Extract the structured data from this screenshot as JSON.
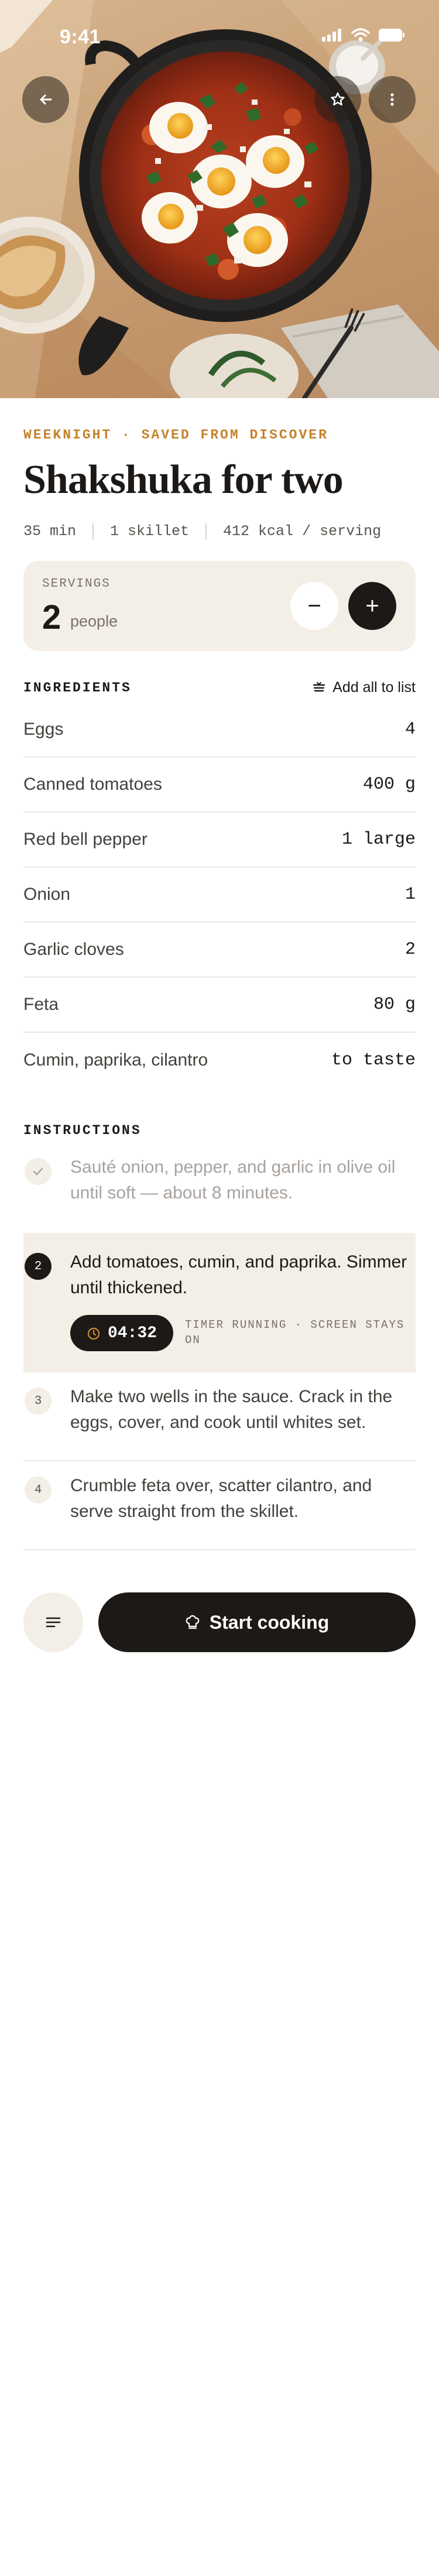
{
  "status": {
    "time": "9:41"
  },
  "recipe": {
    "eyebrow": "WEEKNIGHT · SAVED FROM DISCOVER",
    "title": "Shakshuka for two",
    "meta": [
      "35 min",
      "1 skillet",
      "412 kcal / serving"
    ]
  },
  "servings": {
    "label": "SERVINGS",
    "count": "2",
    "unit": "people",
    "minus": "−",
    "plus": "+"
  },
  "ingredients": {
    "heading": "INGREDIENTS",
    "add_all": "Add all to list",
    "items": [
      {
        "name": "Eggs",
        "qty": "4"
      },
      {
        "name": "Canned tomatoes",
        "qty": "400 g"
      },
      {
        "name": "Red bell pepper",
        "qty": "1 large"
      },
      {
        "name": "Onion",
        "qty": "1"
      },
      {
        "name": "Garlic cloves",
        "qty": "2"
      },
      {
        "name": "Feta",
        "qty": "80 g"
      },
      {
        "name": "Cumin, paprika, cilantro",
        "qty": "to taste"
      }
    ]
  },
  "instructions": {
    "heading": "INSTRUCTIONS",
    "steps": [
      {
        "number": "1",
        "text": "Sauté onion, pepper, and garlic in olive oil until soft — about 8 minutes.",
        "state": "done"
      },
      {
        "number": "2",
        "text": "Add tomatoes, cumin, and paprika. Simmer until thickened.",
        "state": "active"
      },
      {
        "number": "3",
        "text": "Make two wells in the sauce. Crack in the eggs, cover, and cook until whites set.",
        "state": "pending"
      },
      {
        "number": "4",
        "text": "Crumble feta over, scatter cilantro, and serve straight from the skillet.",
        "state": "pending"
      }
    ],
    "timer": {
      "value": "04:32",
      "note": "TIMER RUNNING · SCREEN STAYS ON"
    }
  },
  "actions": {
    "start": "Start cooking"
  },
  "colors": {
    "accent": "#c4822a",
    "ink": "#1c1917",
    "cream": "#f3eee6",
    "muted": "#a8a29e"
  },
  "icons": [
    "back-arrow-icon",
    "star-icon",
    "more-vertical-icon",
    "cart-icon",
    "check-icon",
    "timer-icon",
    "notes-icon",
    "chef-hat-icon"
  ]
}
